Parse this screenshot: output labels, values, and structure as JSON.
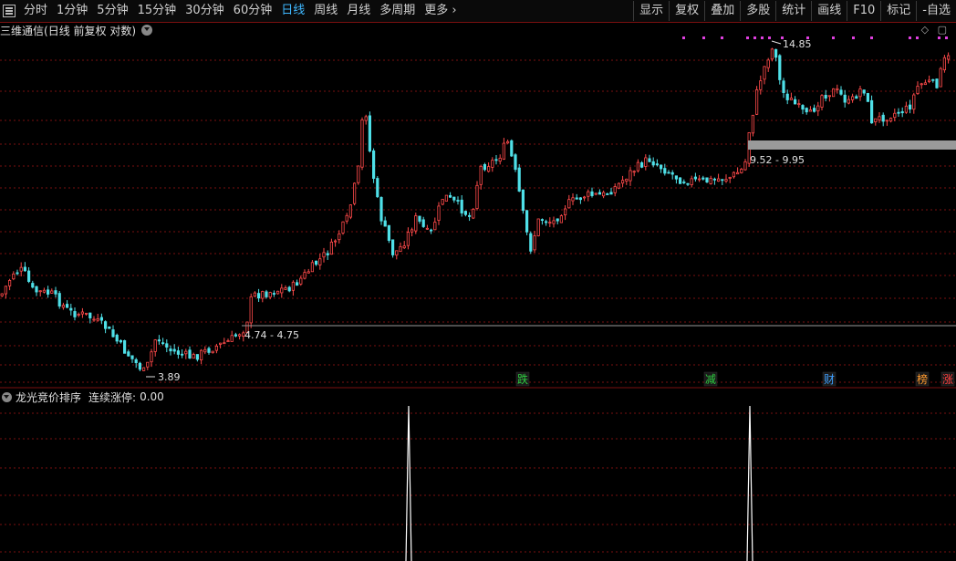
{
  "toolbar": {
    "periods": [
      "分时",
      "1分钟",
      "5分钟",
      "15分钟",
      "30分钟",
      "60分钟",
      "日线",
      "周线",
      "月线",
      "多周期",
      "更多"
    ],
    "active_period": "日线",
    "more_arrow": "›",
    "buttons": [
      "显示",
      "复权",
      "叠加",
      "多股",
      "统计",
      "画线",
      "F10",
      "标记",
      "-自选"
    ]
  },
  "chart_title": {
    "stock_name": "三维通信",
    "mode": "(日线 前复权 对数)"
  },
  "annotations": {
    "high": "14.85",
    "low": "3.89",
    "band_upper": "9.52 - 9.95",
    "band_lower": "4.74 - 4.75"
  },
  "event_tags": [
    {
      "label": "跌",
      "color": "#2ecc40"
    },
    {
      "label": "减",
      "color": "#2ecc40"
    },
    {
      "label": "财",
      "color": "#3fa0ff"
    },
    {
      "label": "榜",
      "color": "#ff9a2e"
    },
    {
      "label": "涨",
      "color": "#ff4040"
    }
  ],
  "indicator": {
    "name": "龙光竞价排序",
    "line_label": "连续涨停:",
    "line_value": "0.00"
  },
  "colors": {
    "up": "#ff4a4a",
    "down": "#4fe0e8",
    "grid": "#7a1010",
    "signal": "#e040e0"
  },
  "icons": {
    "menu": "menu-icon",
    "dropdown": "chevron-down-icon",
    "diamond": "diamond-icon",
    "window": "window-icon"
  }
}
